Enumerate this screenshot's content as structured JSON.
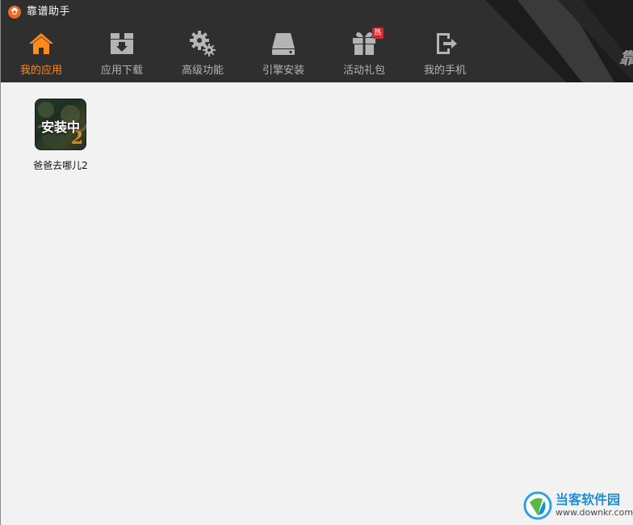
{
  "window": {
    "title": "靠谱助手",
    "brand_fragment": "靠"
  },
  "tabs": [
    {
      "label": "我的应用",
      "icon": "home-icon",
      "active": true
    },
    {
      "label": "应用下载",
      "icon": "download-box-icon",
      "active": false
    },
    {
      "label": "高级功能",
      "icon": "gears-icon",
      "active": false
    },
    {
      "label": "引擎安装",
      "icon": "drive-icon",
      "active": false
    },
    {
      "label": "活动礼包",
      "icon": "gift-icon",
      "active": false,
      "badge": "热"
    },
    {
      "label": "我的手机",
      "icon": "phone-exit-icon",
      "active": false
    }
  ],
  "apps": [
    {
      "name": "爸爸去哪儿2",
      "status": "安装中",
      "icon_digit": "2"
    }
  ],
  "watermark": {
    "name": "当客软件园",
    "url": "www.downkr.com"
  },
  "colors": {
    "header_bg": "#2f2f2f",
    "active_tab": "#ff8a1e",
    "inactive_tab": "#b4b4b4",
    "content_bg": "#f2f2f2",
    "badge": "#d9262b"
  }
}
